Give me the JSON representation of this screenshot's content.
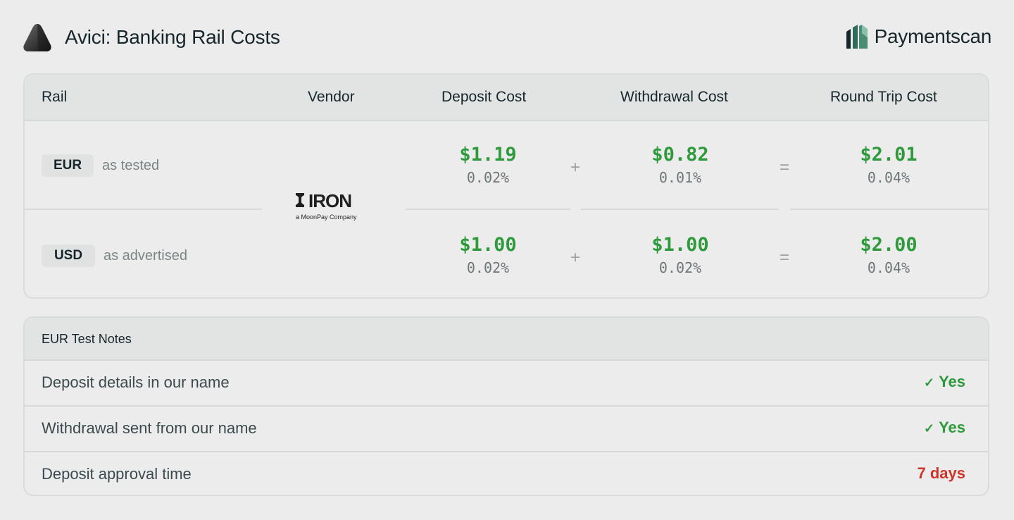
{
  "header": {
    "title": "Avici: Banking Rail Costs",
    "partner_name": "Paymentscan"
  },
  "table": {
    "columns": [
      "Rail",
      "Vendor",
      "Deposit Cost",
      "Withdrawal Cost",
      "Round Trip Cost"
    ],
    "vendor": {
      "name": "IRON",
      "tagline": "a MoonPay Company"
    },
    "rows": [
      {
        "rail": "EUR",
        "note": "as tested",
        "deposit": "$1.19",
        "deposit_pct": "0.02%",
        "withdrawal": "$0.82",
        "withdrawal_pct": "0.01%",
        "round_trip": "$2.01",
        "round_trip_pct": "0.04%"
      },
      {
        "rail": "USD",
        "note": "as advertised",
        "deposit": "$1.00",
        "deposit_pct": "0.02%",
        "withdrawal": "$1.00",
        "withdrawal_pct": "0.02%",
        "round_trip": "$2.00",
        "round_trip_pct": "0.04%"
      }
    ],
    "plus": "+",
    "equals": "="
  },
  "notes": {
    "title": "EUR Test Notes",
    "check_glyph": "✓",
    "items": [
      {
        "label": "Deposit details in our name",
        "value": "Yes",
        "status": "ok"
      },
      {
        "label": "Withdrawal sent from our name",
        "value": "Yes",
        "status": "ok"
      },
      {
        "label": "Deposit approval time",
        "value": "7 days",
        "status": "bad"
      }
    ]
  },
  "colors": {
    "positive": "#2e9a3c",
    "negative": "#d0352b",
    "background": "#ececec",
    "header_bg": "#e2e4e3"
  },
  "icons": {
    "brand": "avici-logo-icon",
    "partner": "paymentscan-logo-icon",
    "check": "check-icon"
  }
}
